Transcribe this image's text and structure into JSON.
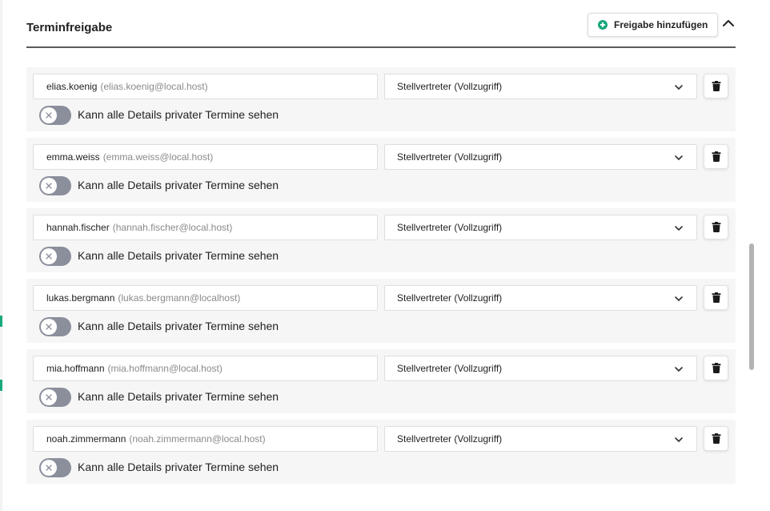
{
  "section": {
    "title": "Terminfreigabe",
    "add_label": "Freigabe hinzufügen"
  },
  "colors": {
    "accent": "#1aa87c",
    "toggle_off": "#8b8f9c",
    "header_rule": "#5b5b5b",
    "row_bg": "#f6f6f6"
  },
  "icons": {
    "add": "plus-circle-icon",
    "collapse": "chevron-up-icon",
    "dropdown": "chevron-down-icon",
    "delete": "trash-icon",
    "toggle": "x-icon"
  },
  "shares": [
    {
      "user": "elias.koenig",
      "email": "(elias.koenig@local.host)",
      "role": "Stellvertreter (Vollzugriff)",
      "private_label": "Kann alle Details privater Termine sehen",
      "private_enabled": false
    },
    {
      "user": "emma.weiss",
      "email": "(emma.weiss@local.host)",
      "role": "Stellvertreter (Vollzugriff)",
      "private_label": "Kann alle Details privater Termine sehen",
      "private_enabled": false
    },
    {
      "user": "hannah.fischer",
      "email": "(hannah.fischer@local.host)",
      "role": "Stellvertreter (Vollzugriff)",
      "private_label": "Kann alle Details privater Termine sehen",
      "private_enabled": false
    },
    {
      "user": "lukas.bergmann",
      "email": "(lukas.bergmann@localhost)",
      "role": "Stellvertreter (Vollzugriff)",
      "private_label": "Kann alle Details privater Termine sehen",
      "private_enabled": false
    },
    {
      "user": "mia.hoffmann",
      "email": "(mia.hoffmann@local.host)",
      "role": "Stellvertreter (Vollzugriff)",
      "private_label": "Kann alle Details privater Termine sehen",
      "private_enabled": false
    },
    {
      "user": "noah.zimmermann",
      "email": "(noah.zimmermann@local.host)",
      "role": "Stellvertreter (Vollzugriff)",
      "private_label": "Kann alle Details privater Termine sehen",
      "private_enabled": false
    }
  ]
}
